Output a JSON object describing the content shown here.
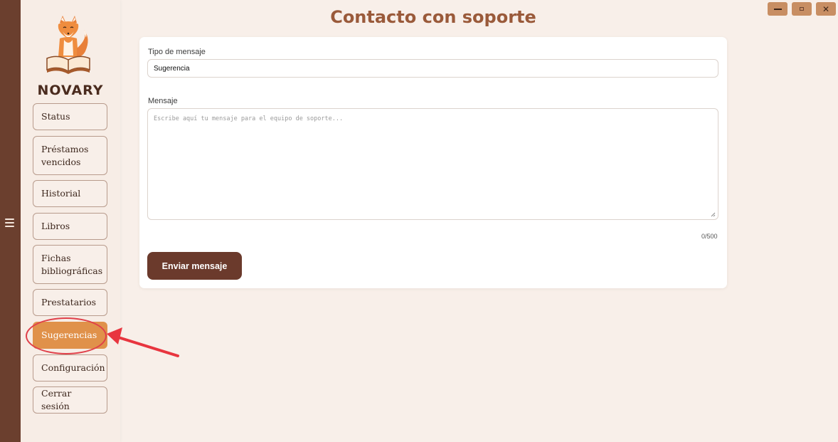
{
  "window": {
    "title": "Contacto con soporte",
    "controls": {
      "minimize_icon": "minimize-icon",
      "maximize_icon": "maximize-icon",
      "close_icon": "close-icon"
    }
  },
  "sidebar": {
    "brand": "NOVARY",
    "logo_icon": "fox-reading-book-logo",
    "items": [
      {
        "label": "Status",
        "active": false
      },
      {
        "label": "Préstamos\nvencidos",
        "active": false
      },
      {
        "label": "Historial",
        "active": false
      },
      {
        "label": "Libros",
        "active": false
      },
      {
        "label": "Fichas\nbibliográficas",
        "active": false
      },
      {
        "label": "Prestatarios",
        "active": false
      },
      {
        "label": "Sugerencias",
        "active": true
      },
      {
        "label": "Configuración",
        "active": false
      },
      {
        "label": "Cerrar sesión",
        "active": false
      }
    ]
  },
  "form": {
    "type_label": "Tipo de mensaje",
    "type_value": "Sugerencia",
    "message_label": "Mensaje",
    "message_placeholder": "Escribe aquí tu mensaje para el equipo de soporte...",
    "counter": "0/500",
    "send_label": "Enviar mensaje"
  },
  "colors": {
    "accent": "#e0914a",
    "primary": "#6b3a2c",
    "title": "#9a5a3a",
    "annotation": "#e0404a"
  }
}
